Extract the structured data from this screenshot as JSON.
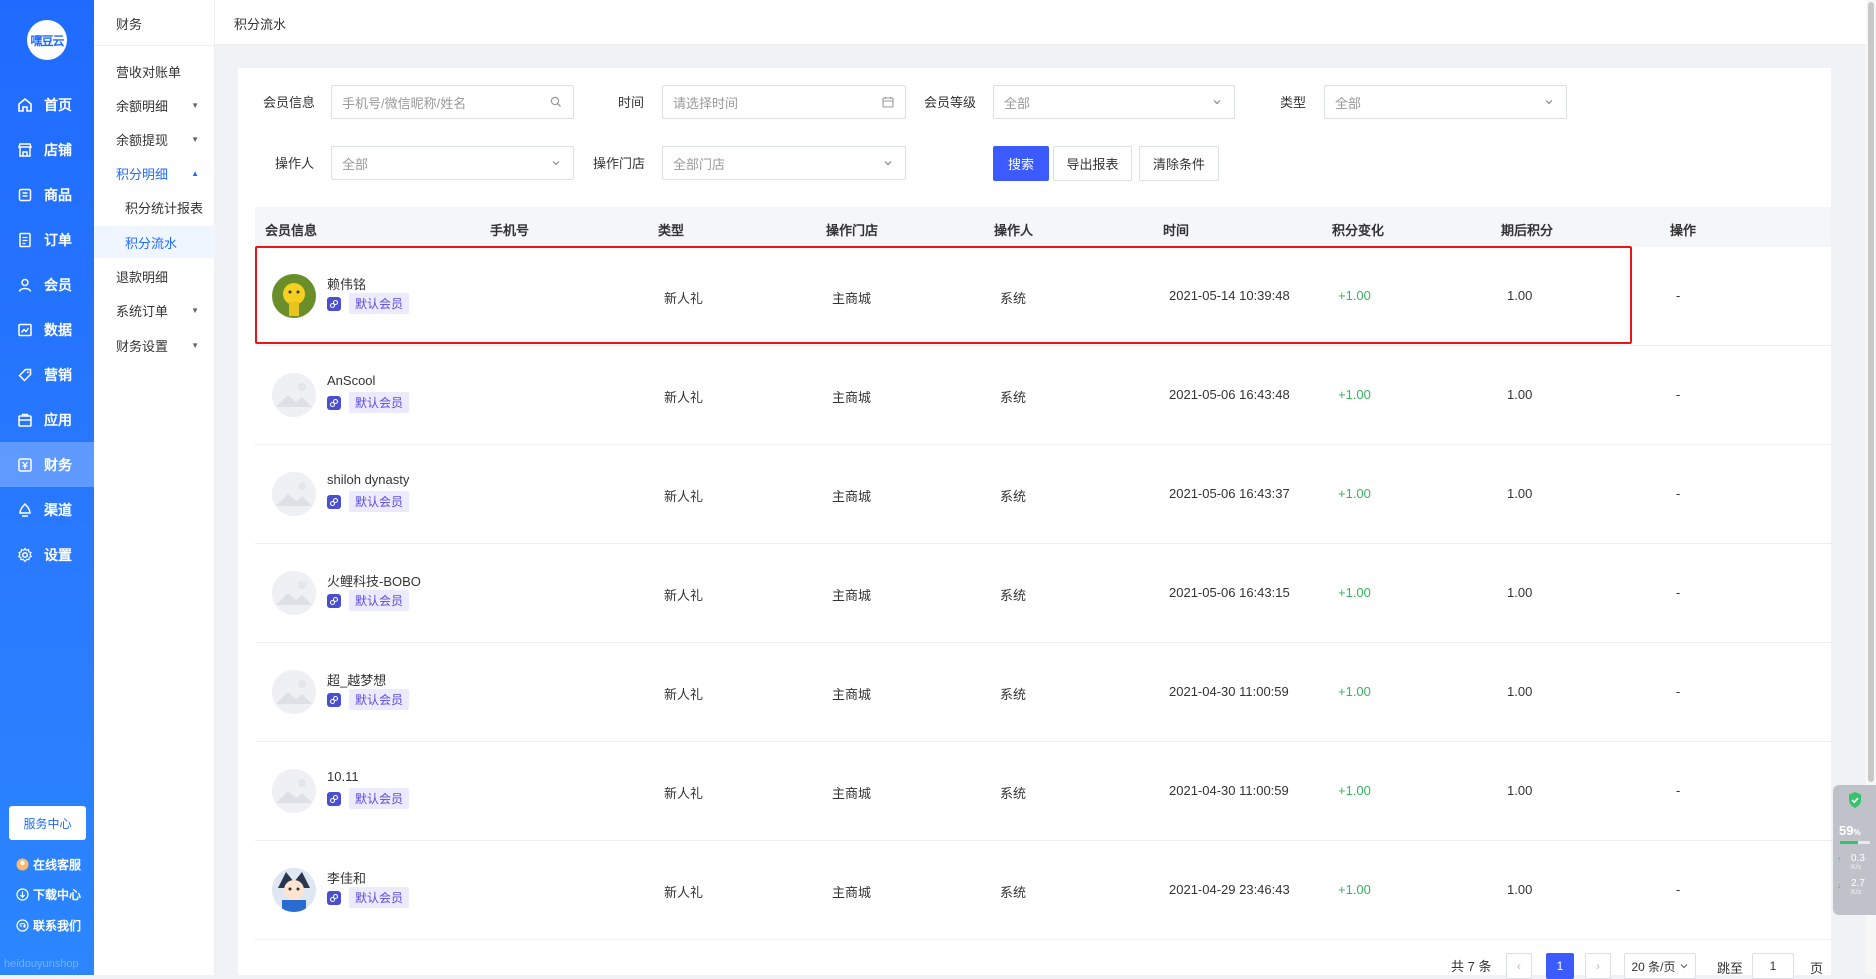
{
  "logo": {
    "text": "嘿豆云"
  },
  "nav": {
    "items": [
      {
        "label": "首页",
        "icon": "home-icon",
        "active": false
      },
      {
        "label": "店铺",
        "icon": "shop-icon",
        "active": false
      },
      {
        "label": "商品",
        "icon": "goods-icon",
        "active": false
      },
      {
        "label": "订单",
        "icon": "order-icon",
        "active": false
      },
      {
        "label": "会员",
        "icon": "member-icon",
        "active": false
      },
      {
        "label": "数据",
        "icon": "data-icon",
        "active": false
      },
      {
        "label": "营销",
        "icon": "tag-icon",
        "active": false
      },
      {
        "label": "应用",
        "icon": "app-icon",
        "active": false
      },
      {
        "label": "财务",
        "icon": "finance-icon",
        "active": true
      },
      {
        "label": "渠道",
        "icon": "channel-icon",
        "active": false
      },
      {
        "label": "设置",
        "icon": "gear-icon",
        "active": false
      }
    ],
    "service_button": "服务中心",
    "links": [
      {
        "label": "在线客服",
        "icon": "avatar-icon"
      },
      {
        "label": "下载中心",
        "icon": "download-icon"
      },
      {
        "label": "联系我们",
        "icon": "contact-icon"
      }
    ],
    "watermark": "heidouyunshop"
  },
  "subnav": {
    "title": "财务",
    "items": [
      {
        "label": "营收对账单",
        "caret": ""
      },
      {
        "label": "余额明细",
        "caret": "▼"
      },
      {
        "label": "余额提现",
        "caret": "▼"
      },
      {
        "label": "积分明细",
        "caret": "▲"
      },
      {
        "label": "退款明细",
        "caret": ""
      },
      {
        "label": "系统订单",
        "caret": "▼"
      },
      {
        "label": "财务设置",
        "caret": "▼"
      }
    ],
    "children": [
      {
        "label": "积分统计报表"
      },
      {
        "label": "积分流水"
      }
    ]
  },
  "breadcrumb": "积分流水",
  "filters": {
    "member_info_label": "会员信息",
    "member_info_placeholder": "手机号/微信昵称/姓名",
    "time_label": "时间",
    "time_placeholder": "请选择时间",
    "level_label": "会员等级",
    "level_value": "全部",
    "type_label": "类型",
    "type_value": "全部",
    "operator_label": "操作人",
    "operator_value": "全部",
    "store_label": "操作门店",
    "store_value": "全部门店",
    "search_button": "搜索",
    "export_button": "导出报表",
    "clear_button": "清除条件"
  },
  "table": {
    "headers": [
      "会员信息",
      "手机号",
      "类型",
      "操作门店",
      "操作人",
      "时间",
      "积分变化",
      "期后积分",
      "操作"
    ],
    "rows": [
      {
        "name": "赖伟铭",
        "tag": "默认会员",
        "phone": "",
        "type": "新人礼",
        "store": "主商城",
        "operator": "系统",
        "time": "2021-05-14 10:39:48",
        "change": "+1.00",
        "after": "1.00",
        "action": "-",
        "avatar": "yellow"
      },
      {
        "name": "AnScool",
        "tag": "默认会员",
        "phone": "",
        "type": "新人礼",
        "store": "主商城",
        "operator": "系统",
        "time": "2021-05-06 16:43:48",
        "change": "+1.00",
        "after": "1.00",
        "action": "-",
        "avatar": "placeholder"
      },
      {
        "name": "shiloh dynasty",
        "tag": "默认会员",
        "phone": "",
        "type": "新人礼",
        "store": "主商城",
        "operator": "系统",
        "time": "2021-05-06 16:43:37",
        "change": "+1.00",
        "after": "1.00",
        "action": "-",
        "avatar": "placeholder"
      },
      {
        "name": "火鲤科技-BOBO",
        "tag": "默认会员",
        "phone": "",
        "type": "新人礼",
        "store": "主商城",
        "operator": "系统",
        "time": "2021-05-06 16:43:15",
        "change": "+1.00",
        "after": "1.00",
        "action": "-",
        "avatar": "placeholder"
      },
      {
        "name": "超_越梦想",
        "tag": "默认会员",
        "phone": "",
        "type": "新人礼",
        "store": "主商城",
        "operator": "系统",
        "time": "2021-04-30 11:00:59",
        "change": "+1.00",
        "after": "1.00",
        "action": "-",
        "avatar": "placeholder"
      },
      {
        "name": "10.11",
        "tag": "默认会员",
        "phone": "",
        "type": "新人礼",
        "store": "主商城",
        "operator": "系统",
        "time": "2021-04-30 11:00:59",
        "change": "+1.00",
        "after": "1.00",
        "action": "-",
        "avatar": "placeholder"
      },
      {
        "name": "李佳和",
        "tag": "默认会员",
        "phone": "",
        "type": "新人礼",
        "store": "主商城",
        "operator": "系统",
        "time": "2021-04-29 23:46:43",
        "change": "+1.00",
        "after": "1.00",
        "action": "-",
        "avatar": "anime"
      }
    ]
  },
  "pagination": {
    "total": "共 7 条",
    "prev": "‹",
    "current": "1",
    "next": "›",
    "page_size": "20 条/页",
    "jump_label": "跳至",
    "jump_value": "1",
    "page_unit": "页"
  },
  "widget": {
    "percent": "59",
    "percent_unit": "%",
    "up_speed": "0.3",
    "up_unit": "K/s",
    "down_speed": "2.7",
    "down_unit": "K/s"
  },
  "colors": {
    "nav_blue": "#1f6bff",
    "primary_button": "#3b5bff",
    "positive_green": "#35b55f",
    "highlight_red": "#e8161b",
    "tag_purple": "#5a4be0"
  }
}
